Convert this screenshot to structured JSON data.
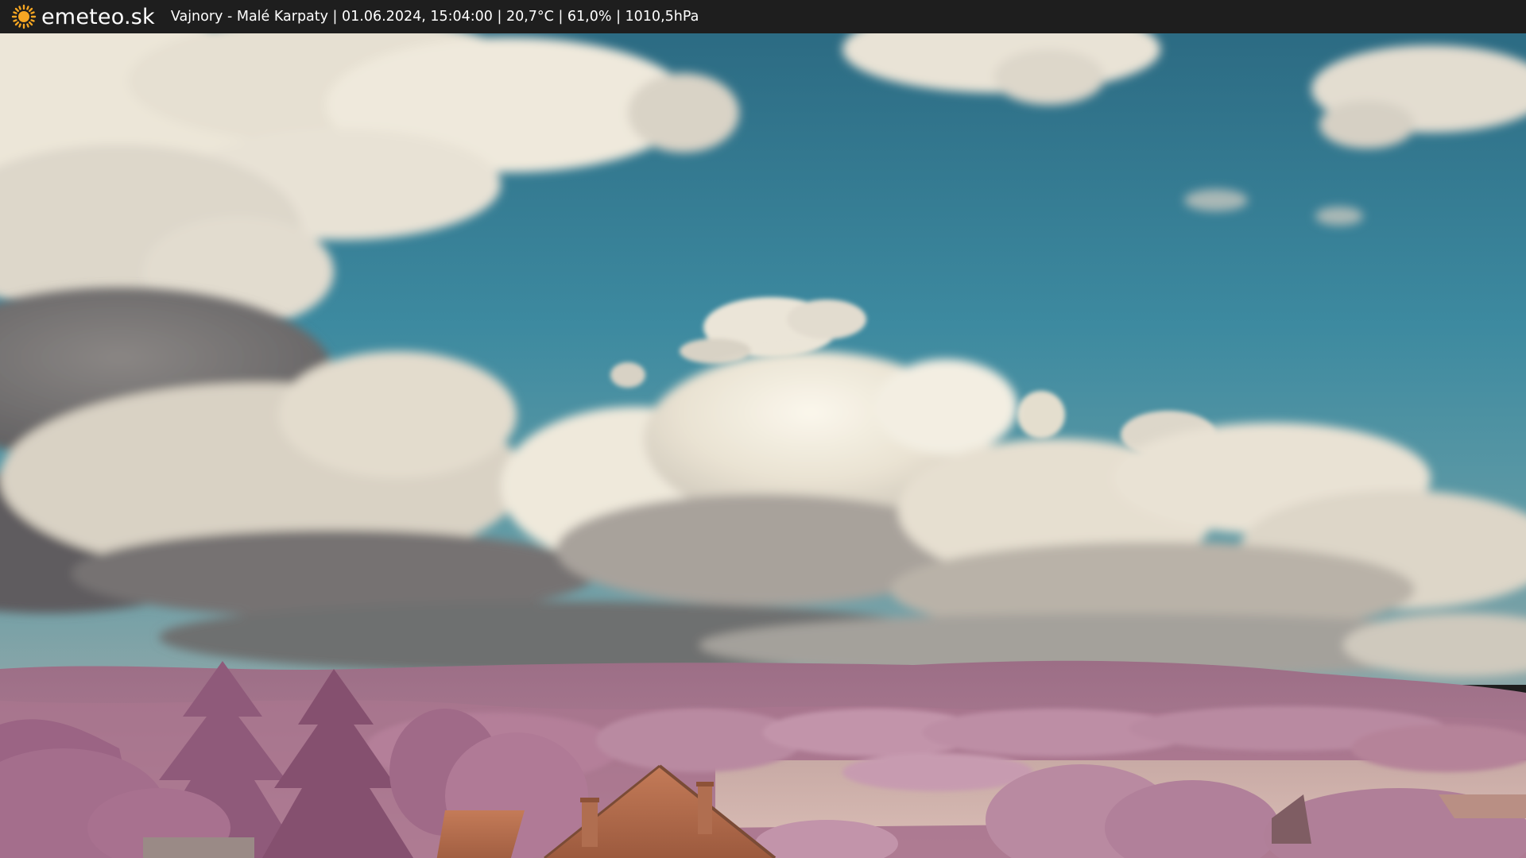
{
  "header": {
    "logo_text": "emeteo.sk",
    "logo_icon": "sun-icon",
    "caption": "Vajnory - Malé Karpaty | 01.06.2024, 15:04:00 | 20,7°C | 61,0% | 1010,5hPa"
  },
  "colors": {
    "bar_background": "#1e1e1e",
    "sun_icon": "#f5a623",
    "sky_top": "#2f6f86",
    "sky_bottom": "#4d97a8",
    "cloud_light": "#efe9dc",
    "cloud_shadow": "#6f6d6c",
    "foliage": "#b77c9b",
    "field": "#c9a8a3",
    "roof": "#b46a48"
  }
}
